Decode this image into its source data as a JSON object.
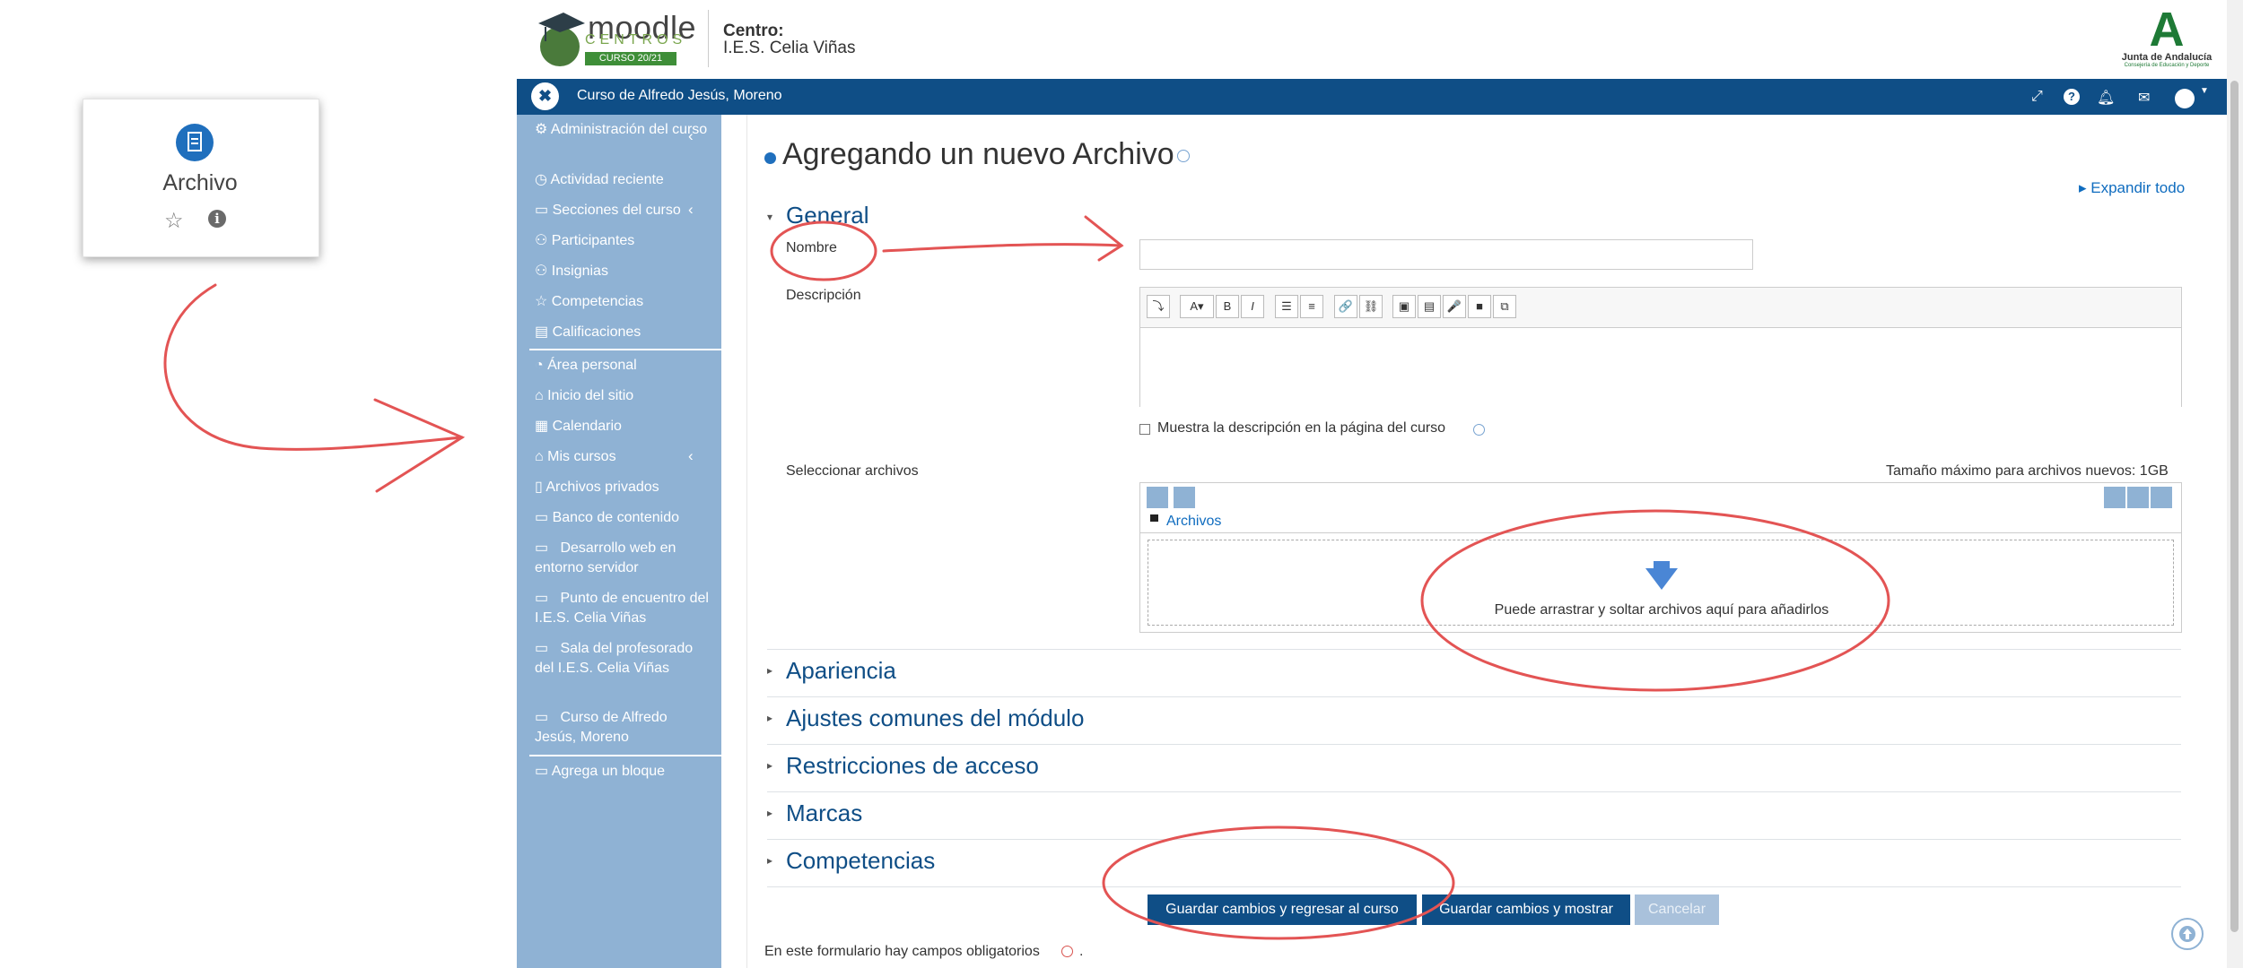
{
  "card": {
    "title": "Archivo",
    "icon": "file-icon",
    "star_icon": "☆",
    "info_icon": "i"
  },
  "header": {
    "logo": {
      "name": "moodle",
      "sub": "CENTROS",
      "badge": "CURSO 20/21"
    },
    "centro_label": "Centro:",
    "centro_name": "I.E.S. Celia Viñas",
    "junta": {
      "letter": "A",
      "name": "Junta de Andalucía",
      "sub": "Consejería de Educación y Deporte"
    }
  },
  "navbar": {
    "title": "Curso de Alfredo Jesús, Moreno",
    "icons": [
      "expand-icon",
      "help-icon",
      "bell-icon",
      "mail-icon",
      "user-avatar"
    ]
  },
  "sidebar": {
    "items": [
      {
        "label": "Administración del curso",
        "icon": "gear-icon"
      },
      {
        "label": "Actividad reciente",
        "icon": "clock-icon"
      },
      {
        "label": "Secciones del curso",
        "icon": "folder-icon"
      },
      {
        "label": "Participantes",
        "icon": "users-icon"
      },
      {
        "label": "Insignias",
        "icon": "badge-icon"
      },
      {
        "label": "Competencias",
        "icon": "star-icon"
      },
      {
        "label": "Calificaciones",
        "icon": "table-icon"
      },
      {
        "label": "Área personal",
        "icon": "dashboard-icon"
      },
      {
        "label": "Inicio del sitio",
        "icon": "home-icon"
      },
      {
        "label": "Calendario",
        "icon": "calendar-icon"
      },
      {
        "label": "Mis cursos",
        "icon": "graduation-icon"
      },
      {
        "label": "Archivos privados",
        "icon": "file-icon"
      },
      {
        "label": "Banco de contenido",
        "icon": "folder-icon"
      },
      {
        "label": "Desarrollo web en entorno servidor",
        "icon": "folder-icon"
      },
      {
        "label": "Punto de encuentro del I.E.S. Celia Viñas",
        "icon": "folder-icon"
      },
      {
        "label": "Sala del profesorado del I.E.S. Celia Viñas",
        "icon": "folder-icon"
      },
      {
        "label": "Curso de Alfredo Jesús, Moreno",
        "icon": "folder-icon"
      },
      {
        "label": "Agrega un bloque",
        "icon": "folder-icon"
      }
    ]
  },
  "main": {
    "title": "Agregando un nuevo Archivo",
    "expand_all": "Expandir todo",
    "sections": {
      "general": "General",
      "apariencia": "Apariencia",
      "ajustes": "Ajustes comunes del módulo",
      "restricciones": "Restricciones de acceso",
      "marcas": "Marcas",
      "competencias": "Competencias"
    },
    "fields": {
      "nombre_label": "Nombre",
      "nombre_value": "",
      "descripcion_label": "Descripción",
      "show_description": "Muestra la descripción en la página del curso",
      "select_files_label": "Seleccionar archivos",
      "max_size": "Tamaño máximo para archivos nuevos: 1GB",
      "folder": "Archivos",
      "drop_text": "Puede arrastrar y soltar archivos aquí para añadirlos"
    },
    "toolbar": [
      "⤵",
      "A▾",
      "B",
      "I",
      "☰",
      "≡",
      "🔗",
      "⛓",
      "▣",
      "▤",
      "🎤",
      "■",
      "⧉"
    ],
    "buttons": {
      "save_return": "Guardar cambios y regresar al curso",
      "save_show": "Guardar cambios y mostrar",
      "cancel": "Cancelar"
    },
    "required_note": "En este formulario hay campos obligatorios",
    "required_dot": "."
  }
}
